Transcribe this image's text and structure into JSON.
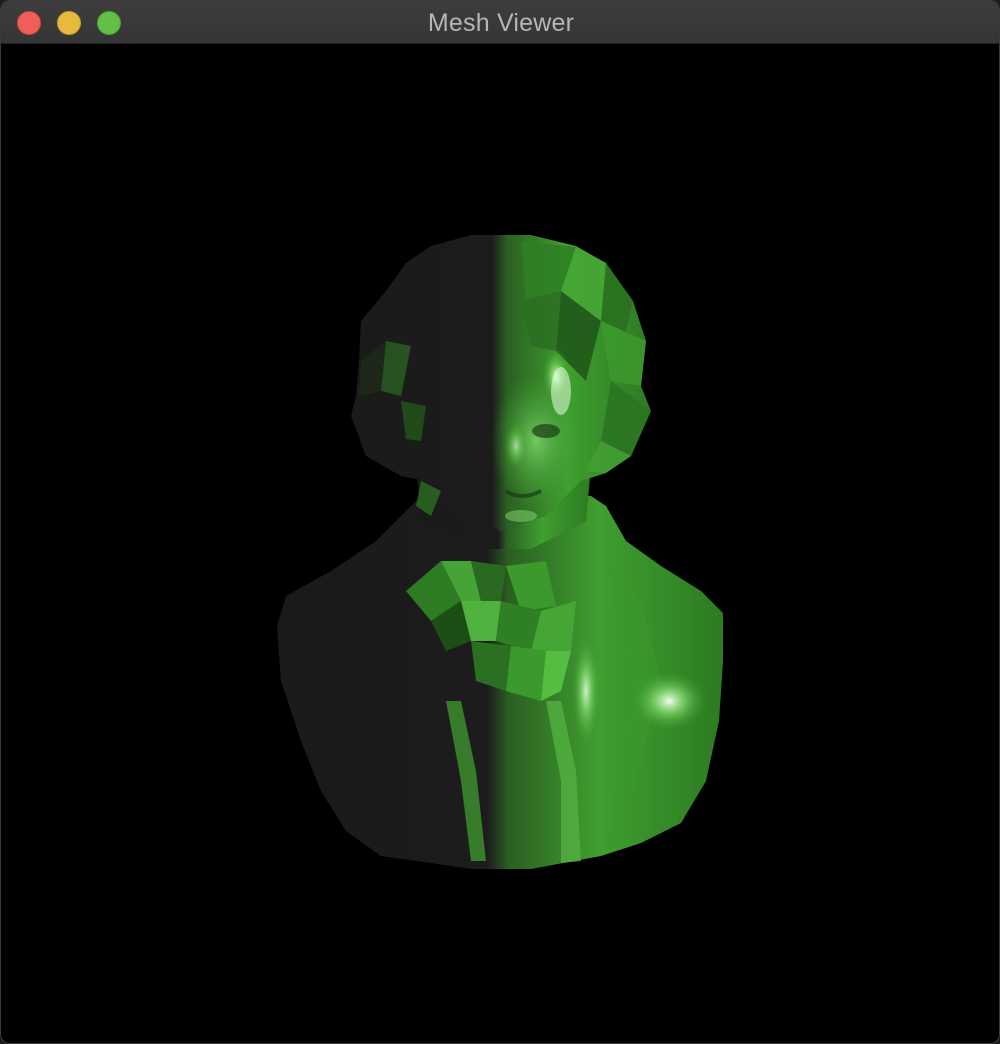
{
  "window": {
    "title": "Mesh Viewer",
    "controls": [
      "close",
      "minimize",
      "zoom"
    ]
  },
  "viewport": {
    "background": "#000000",
    "model_color": "#3fa531",
    "shadow_color": "#181818",
    "highlight_color": "#d9ffd0"
  }
}
